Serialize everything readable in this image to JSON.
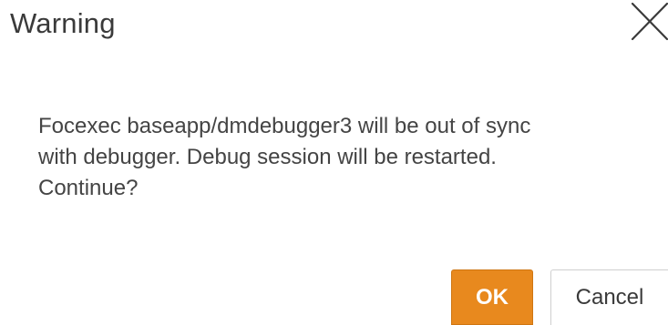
{
  "dialog": {
    "title": "Warning",
    "close_icon": "close-x-icon",
    "message_lines": [
      "Focexec baseapp/dmdebugger3 will be out of sync",
      "with debugger. Debug session will be restarted.",
      "Continue?"
    ],
    "buttons": {
      "ok_label": "OK",
      "cancel_label": "Cancel"
    }
  },
  "colors": {
    "primary_button": "#e8891e",
    "background": "#ffffff",
    "text": "#444444"
  }
}
